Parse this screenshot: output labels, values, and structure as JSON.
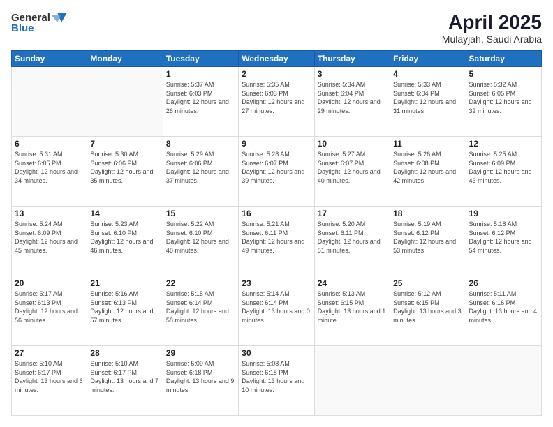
{
  "header": {
    "logo_general": "General",
    "logo_blue": "Blue",
    "month_year": "April 2025",
    "location": "Mulayjah, Saudi Arabia"
  },
  "columns": [
    "Sunday",
    "Monday",
    "Tuesday",
    "Wednesday",
    "Thursday",
    "Friday",
    "Saturday"
  ],
  "weeks": [
    [
      {
        "day": "",
        "sunrise": "",
        "sunset": "",
        "daylight": ""
      },
      {
        "day": "",
        "sunrise": "",
        "sunset": "",
        "daylight": ""
      },
      {
        "day": "1",
        "sunrise": "Sunrise: 5:37 AM",
        "sunset": "Sunset: 6:03 PM",
        "daylight": "Daylight: 12 hours and 26 minutes."
      },
      {
        "day": "2",
        "sunrise": "Sunrise: 5:35 AM",
        "sunset": "Sunset: 6:03 PM",
        "daylight": "Daylight: 12 hours and 27 minutes."
      },
      {
        "day": "3",
        "sunrise": "Sunrise: 5:34 AM",
        "sunset": "Sunset: 6:04 PM",
        "daylight": "Daylight: 12 hours and 29 minutes."
      },
      {
        "day": "4",
        "sunrise": "Sunrise: 5:33 AM",
        "sunset": "Sunset: 6:04 PM",
        "daylight": "Daylight: 12 hours and 31 minutes."
      },
      {
        "day": "5",
        "sunrise": "Sunrise: 5:32 AM",
        "sunset": "Sunset: 6:05 PM",
        "daylight": "Daylight: 12 hours and 32 minutes."
      }
    ],
    [
      {
        "day": "6",
        "sunrise": "Sunrise: 5:31 AM",
        "sunset": "Sunset: 6:05 PM",
        "daylight": "Daylight: 12 hours and 34 minutes."
      },
      {
        "day": "7",
        "sunrise": "Sunrise: 5:30 AM",
        "sunset": "Sunset: 6:06 PM",
        "daylight": "Daylight: 12 hours and 35 minutes."
      },
      {
        "day": "8",
        "sunrise": "Sunrise: 5:29 AM",
        "sunset": "Sunset: 6:06 PM",
        "daylight": "Daylight: 12 hours and 37 minutes."
      },
      {
        "day": "9",
        "sunrise": "Sunrise: 5:28 AM",
        "sunset": "Sunset: 6:07 PM",
        "daylight": "Daylight: 12 hours and 39 minutes."
      },
      {
        "day": "10",
        "sunrise": "Sunrise: 5:27 AM",
        "sunset": "Sunset: 6:07 PM",
        "daylight": "Daylight: 12 hours and 40 minutes."
      },
      {
        "day": "11",
        "sunrise": "Sunrise: 5:26 AM",
        "sunset": "Sunset: 6:08 PM",
        "daylight": "Daylight: 12 hours and 42 minutes."
      },
      {
        "day": "12",
        "sunrise": "Sunrise: 5:25 AM",
        "sunset": "Sunset: 6:09 PM",
        "daylight": "Daylight: 12 hours and 43 minutes."
      }
    ],
    [
      {
        "day": "13",
        "sunrise": "Sunrise: 5:24 AM",
        "sunset": "Sunset: 6:09 PM",
        "daylight": "Daylight: 12 hours and 45 minutes."
      },
      {
        "day": "14",
        "sunrise": "Sunrise: 5:23 AM",
        "sunset": "Sunset: 6:10 PM",
        "daylight": "Daylight: 12 hours and 46 minutes."
      },
      {
        "day": "15",
        "sunrise": "Sunrise: 5:22 AM",
        "sunset": "Sunset: 6:10 PM",
        "daylight": "Daylight: 12 hours and 48 minutes."
      },
      {
        "day": "16",
        "sunrise": "Sunrise: 5:21 AM",
        "sunset": "Sunset: 6:11 PM",
        "daylight": "Daylight: 12 hours and 49 minutes."
      },
      {
        "day": "17",
        "sunrise": "Sunrise: 5:20 AM",
        "sunset": "Sunset: 6:11 PM",
        "daylight": "Daylight: 12 hours and 51 minutes."
      },
      {
        "day": "18",
        "sunrise": "Sunrise: 5:19 AM",
        "sunset": "Sunset: 6:12 PM",
        "daylight": "Daylight: 12 hours and 53 minutes."
      },
      {
        "day": "19",
        "sunrise": "Sunrise: 5:18 AM",
        "sunset": "Sunset: 6:12 PM",
        "daylight": "Daylight: 12 hours and 54 minutes."
      }
    ],
    [
      {
        "day": "20",
        "sunrise": "Sunrise: 5:17 AM",
        "sunset": "Sunset: 6:13 PM",
        "daylight": "Daylight: 12 hours and 56 minutes."
      },
      {
        "day": "21",
        "sunrise": "Sunrise: 5:16 AM",
        "sunset": "Sunset: 6:13 PM",
        "daylight": "Daylight: 12 hours and 57 minutes."
      },
      {
        "day": "22",
        "sunrise": "Sunrise: 5:15 AM",
        "sunset": "Sunset: 6:14 PM",
        "daylight": "Daylight: 12 hours and 58 minutes."
      },
      {
        "day": "23",
        "sunrise": "Sunrise: 5:14 AM",
        "sunset": "Sunset: 6:14 PM",
        "daylight": "Daylight: 13 hours and 0 minutes."
      },
      {
        "day": "24",
        "sunrise": "Sunrise: 5:13 AM",
        "sunset": "Sunset: 6:15 PM",
        "daylight": "Daylight: 13 hours and 1 minute."
      },
      {
        "day": "25",
        "sunrise": "Sunrise: 5:12 AM",
        "sunset": "Sunset: 6:15 PM",
        "daylight": "Daylight: 13 hours and 3 minutes."
      },
      {
        "day": "26",
        "sunrise": "Sunrise: 5:11 AM",
        "sunset": "Sunset: 6:16 PM",
        "daylight": "Daylight: 13 hours and 4 minutes."
      }
    ],
    [
      {
        "day": "27",
        "sunrise": "Sunrise: 5:10 AM",
        "sunset": "Sunset: 6:17 PM",
        "daylight": "Daylight: 13 hours and 6 minutes."
      },
      {
        "day": "28",
        "sunrise": "Sunrise: 5:10 AM",
        "sunset": "Sunset: 6:17 PM",
        "daylight": "Daylight: 13 hours and 7 minutes."
      },
      {
        "day": "29",
        "sunrise": "Sunrise: 5:09 AM",
        "sunset": "Sunset: 6:18 PM",
        "daylight": "Daylight: 13 hours and 9 minutes."
      },
      {
        "day": "30",
        "sunrise": "Sunrise: 5:08 AM",
        "sunset": "Sunset: 6:18 PM",
        "daylight": "Daylight: 13 hours and 10 minutes."
      },
      {
        "day": "",
        "sunrise": "",
        "sunset": "",
        "daylight": ""
      },
      {
        "day": "",
        "sunrise": "",
        "sunset": "",
        "daylight": ""
      },
      {
        "day": "",
        "sunrise": "",
        "sunset": "",
        "daylight": ""
      }
    ]
  ]
}
